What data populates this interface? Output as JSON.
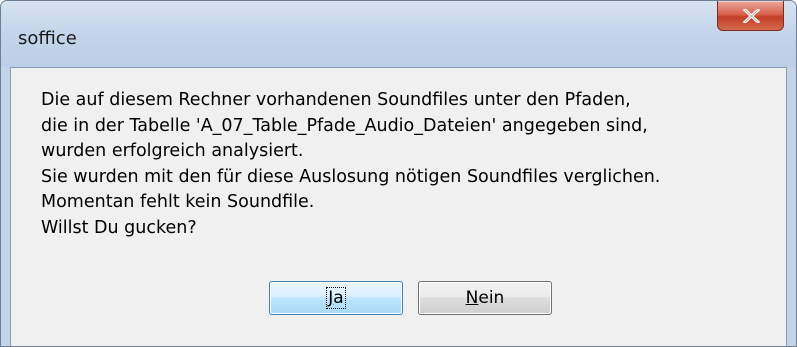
{
  "window": {
    "title": "soffice",
    "close_icon": "close-x-icon"
  },
  "dialog": {
    "message_lines": [
      "Die auf diesem Rechner vorhandenen Soundfiles unter den Pfaden,",
      "die in der Tabelle 'A_07_Table_Pfade_Audio_Dateien' angegeben sind,",
      "wurden erfolgreich analysiert.",
      "Sie wurden mit den für diese Auslosung nötigen Soundfiles verglichen.",
      "Momentan fehlt kein Soundfile.",
      "Willst Du gucken?"
    ],
    "buttons": {
      "yes_mnemonic": "J",
      "yes_rest": "a",
      "no_mnemonic": "N",
      "no_rest": "ein"
    }
  },
  "colors": {
    "close_button": "#c94a32",
    "default_button_border": "#3c7fb1",
    "dialog_background": "#f0f0f0",
    "frame": "#c4d5ea"
  }
}
